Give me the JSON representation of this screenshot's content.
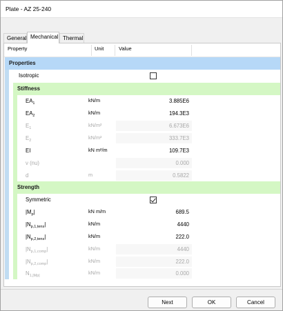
{
  "window": {
    "title": "Plate - AZ 25-240"
  },
  "tabs": [
    {
      "label": "General",
      "active": false
    },
    {
      "label": "Mechanical",
      "active": true
    },
    {
      "label": "Thermal",
      "active": false
    }
  ],
  "grid": {
    "columns": {
      "property": "Property",
      "unit": "Unit",
      "value": "Value"
    },
    "sections": {
      "properties": "Properties",
      "stiffness": "Stiffness",
      "strength": "Strength"
    },
    "rows": {
      "isotropic": {
        "label": "Isotropic",
        "checked": false
      },
      "ea1": {
        "label": "EA",
        "sub": "1",
        "unit": "kN/m",
        "value": "3.885E6"
      },
      "ea2": {
        "label": "EA",
        "sub": "2",
        "unit": "kN/m",
        "value": "194.3E3"
      },
      "e1": {
        "label": "E",
        "sub": "1",
        "unit": "kN/m²",
        "value": "6.673E6"
      },
      "e2": {
        "label": "E",
        "sub": "2",
        "unit": "kN/m²",
        "value": "333.7E3"
      },
      "ei": {
        "label": "EI",
        "unit": "kN m²/m",
        "value": "109.7E3"
      },
      "nu": {
        "label": "ν (nu)",
        "unit": "",
        "value": "0.000"
      },
      "d": {
        "label": "d",
        "unit": "m",
        "value": "0.5822"
      },
      "symmetric": {
        "label": "Symmetric",
        "checked": true
      },
      "mp": {
        "label_pre": "|M",
        "sub": "p",
        "label_post": "|",
        "unit": "kN m/m",
        "value": "689.5"
      },
      "np1tens": {
        "label_pre": "|N",
        "sub": "p,1,tens",
        "label_post": "|",
        "unit": "kN/m",
        "value": "4440"
      },
      "np2tens": {
        "label_pre": "|N",
        "sub": "p,2,tens",
        "label_post": "|",
        "unit": "kN/m",
        "value": "222.0"
      },
      "np1comp": {
        "label_pre": "|N",
        "sub": "p,1,comp",
        "label_post": "|",
        "unit": "kN/m",
        "value": "4440"
      },
      "np2comp": {
        "label_pre": "|N",
        "sub": "p,2,comp",
        "label_post": "|",
        "unit": "kN/m",
        "value": "222.0"
      },
      "n1mp": {
        "label_pre": "N",
        "sub": "1,|Mp|",
        "label_post": "",
        "unit": "kN/m",
        "value": "0.000"
      }
    }
  },
  "buttons": {
    "next": "Next",
    "ok": "OK",
    "cancel": "Cancel"
  }
}
